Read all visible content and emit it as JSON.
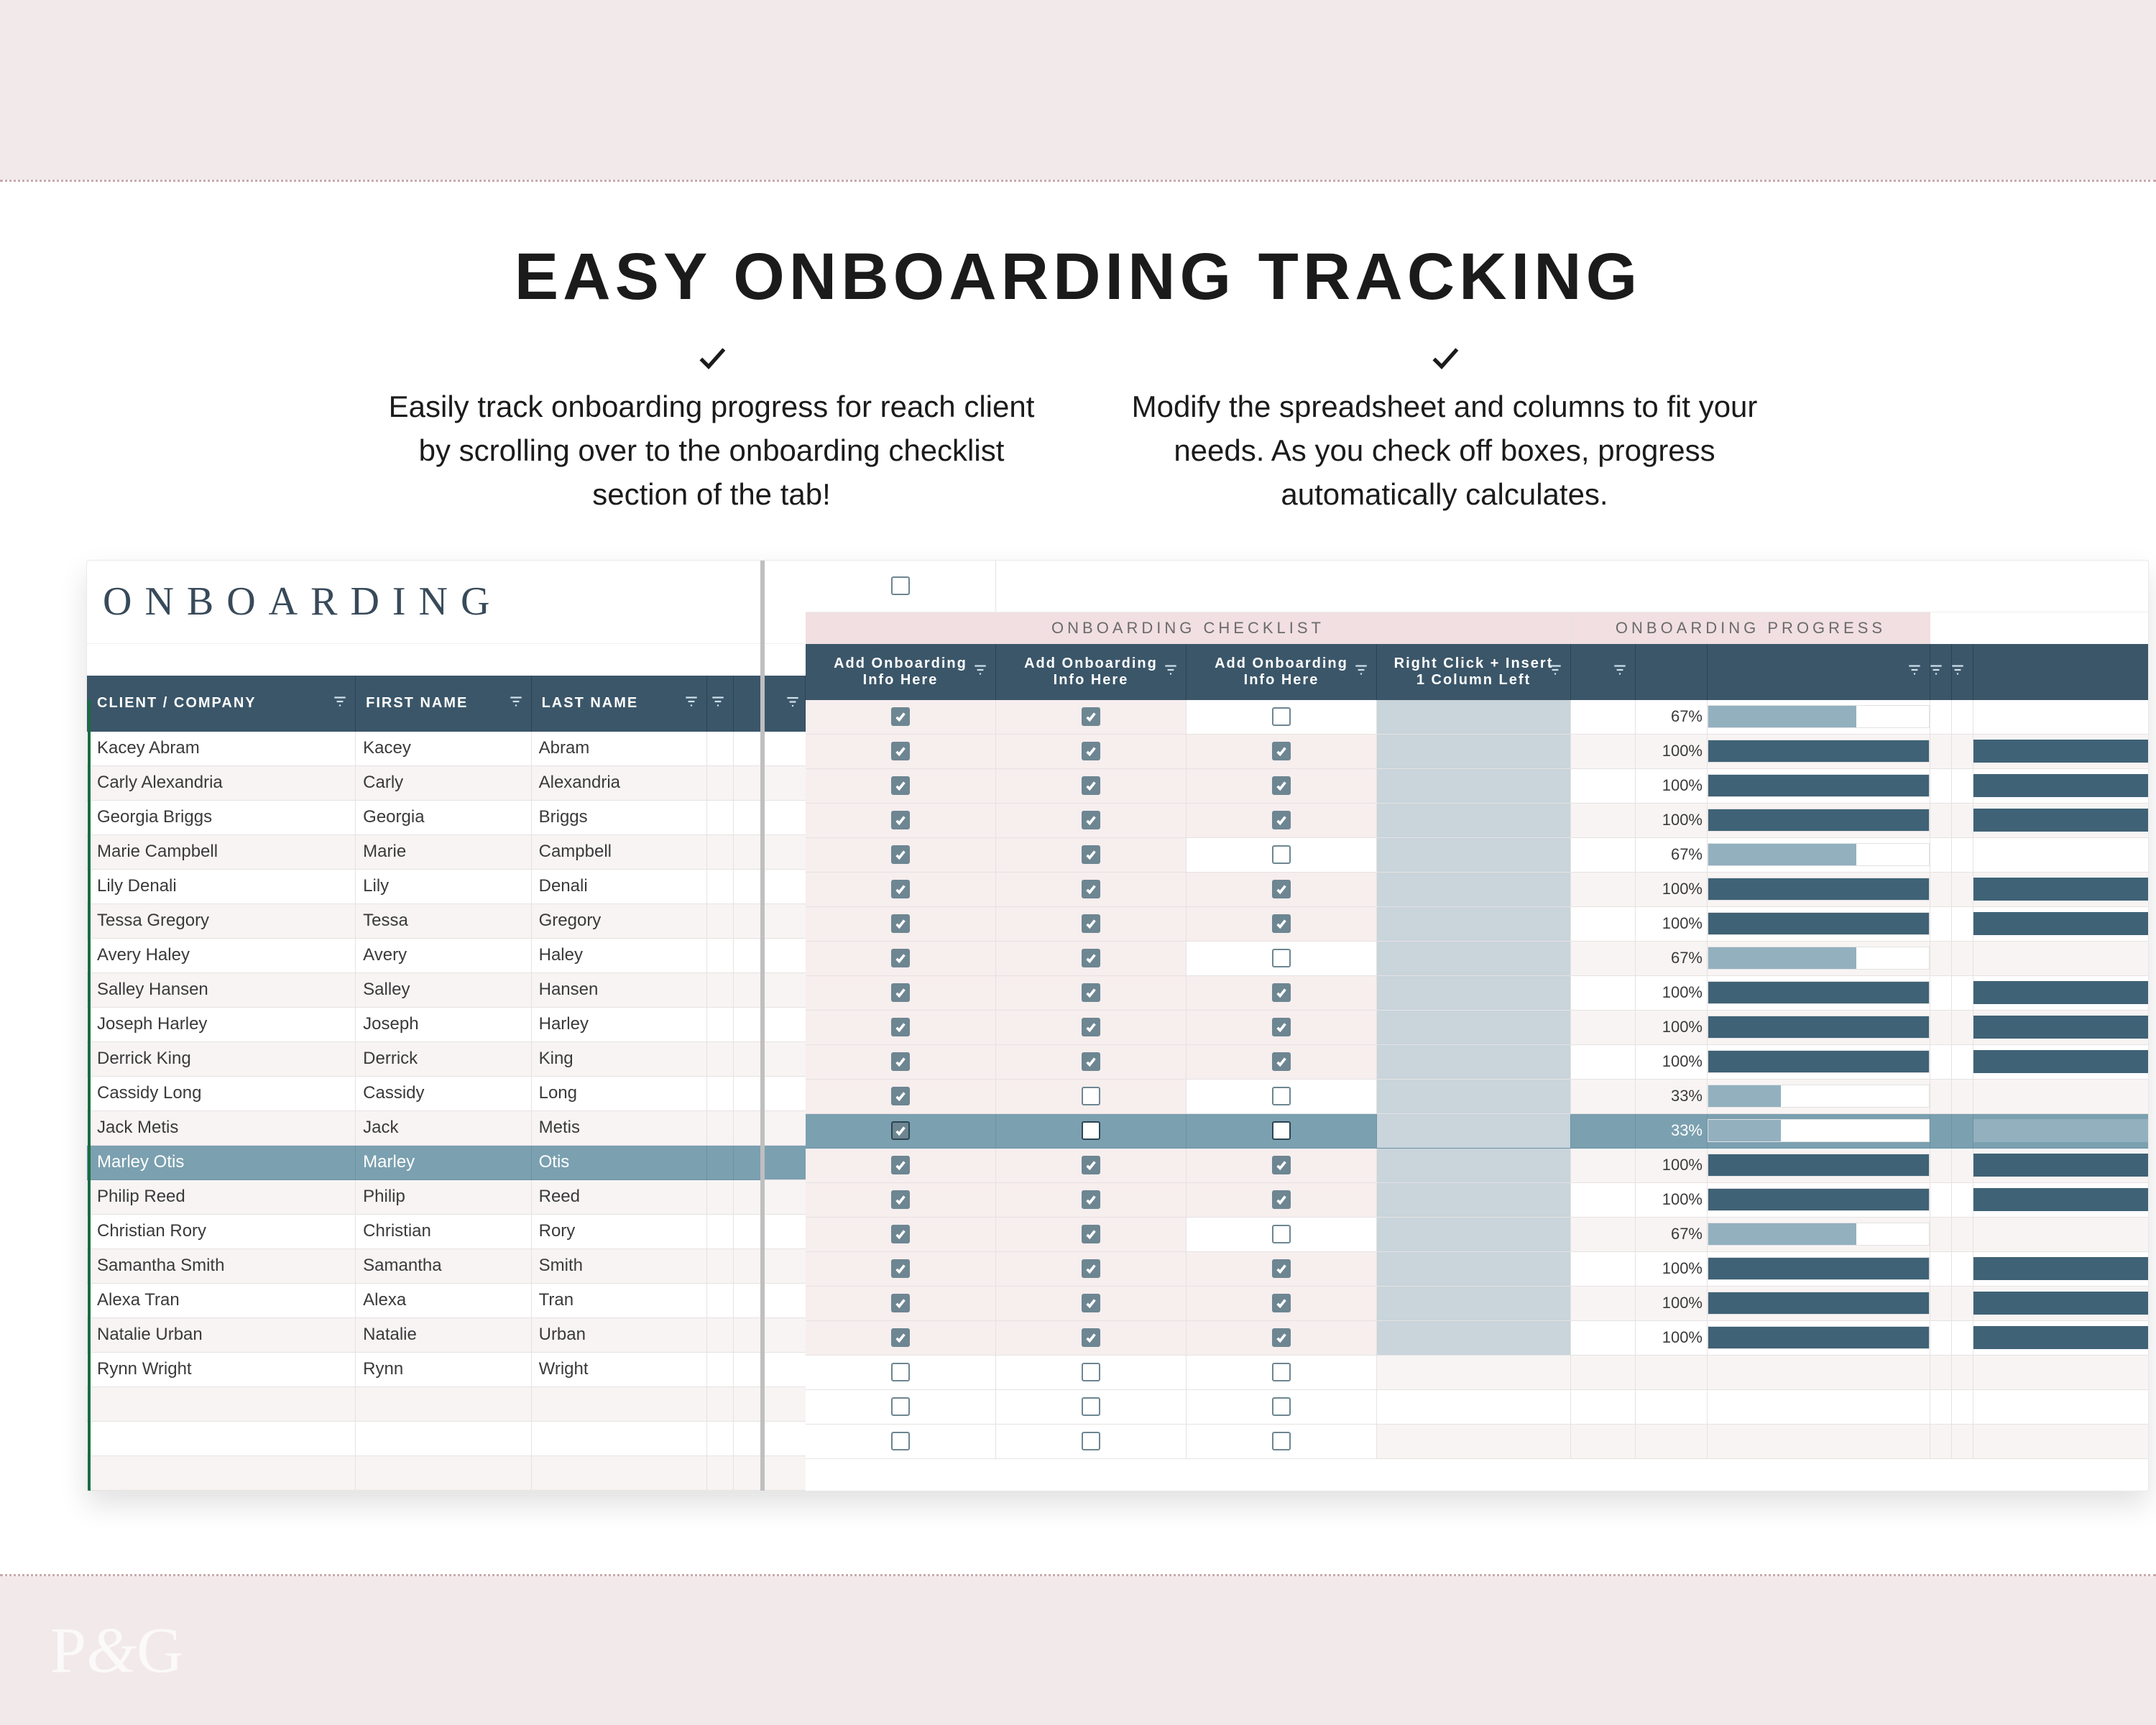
{
  "hero": {
    "title": "EASY ONBOARDING TRACKING",
    "feature_a": "Easily track onboarding progress for reach client by scrolling over to the onboarding checklist section of the tab!",
    "feature_b": "Modify the spreadsheet and columns to fit your needs. As you check off boxes, progress automatically calculates."
  },
  "sheet": {
    "title": "ONBOARDING",
    "section_labels": {
      "checklist": "ONBOARDING CHECKLIST",
      "progress": "ONBOARDING PROGRESS"
    },
    "columns": {
      "company": "CLIENT / COMPANY",
      "first": "FIRST NAME",
      "last": "LAST NAME",
      "chk1": "Add Onboarding Info Here",
      "chk2": "Add Onboarding Info Here",
      "chk3": "Add Onboarding Info Here",
      "rc": "Right Click + Insert 1 Column Left"
    },
    "rows": [
      {
        "company": "Kacey Abram",
        "first": "Kacey",
        "last": "Abram",
        "c": [
          true,
          true,
          false
        ],
        "pct": 67
      },
      {
        "company": "Carly Alexandria",
        "first": "Carly",
        "last": "Alexandria",
        "c": [
          true,
          true,
          true
        ],
        "pct": 100
      },
      {
        "company": "Georgia Briggs",
        "first": "Georgia",
        "last": "Briggs",
        "c": [
          true,
          true,
          true
        ],
        "pct": 100
      },
      {
        "company": "Marie Campbell",
        "first": "Marie",
        "last": "Campbell",
        "c": [
          true,
          true,
          true
        ],
        "pct": 100
      },
      {
        "company": "Lily Denali",
        "first": "Lily",
        "last": "Denali",
        "c": [
          true,
          true,
          false
        ],
        "pct": 67
      },
      {
        "company": "Tessa Gregory",
        "first": "Tessa",
        "last": "Gregory",
        "c": [
          true,
          true,
          true
        ],
        "pct": 100
      },
      {
        "company": "Avery Haley",
        "first": "Avery",
        "last": "Haley",
        "c": [
          true,
          true,
          true
        ],
        "pct": 100
      },
      {
        "company": "Salley Hansen",
        "first": "Salley",
        "last": "Hansen",
        "c": [
          true,
          true,
          false
        ],
        "pct": 67
      },
      {
        "company": "Joseph Harley",
        "first": "Joseph",
        "last": "Harley",
        "c": [
          true,
          true,
          true
        ],
        "pct": 100
      },
      {
        "company": "Derrick King",
        "first": "Derrick",
        "last": "King",
        "c": [
          true,
          true,
          true
        ],
        "pct": 100
      },
      {
        "company": "Cassidy Long",
        "first": "Cassidy",
        "last": "Long",
        "c": [
          true,
          true,
          true
        ],
        "pct": 100
      },
      {
        "company": "Jack Metis",
        "first": "Jack",
        "last": "Metis",
        "c": [
          true,
          false,
          false
        ],
        "pct": 33
      },
      {
        "company": "Marley Otis",
        "first": "Marley",
        "last": "Otis",
        "c": [
          true,
          false,
          false
        ],
        "pct": 33,
        "highlight": true
      },
      {
        "company": "Philip Reed",
        "first": "Philip",
        "last": "Reed",
        "c": [
          true,
          true,
          true
        ],
        "pct": 100
      },
      {
        "company": "Christian Rory",
        "first": "Christian",
        "last": "Rory",
        "c": [
          true,
          true,
          true
        ],
        "pct": 100
      },
      {
        "company": "Samantha Smith",
        "first": "Samantha",
        "last": "Smith",
        "c": [
          true,
          true,
          false
        ],
        "pct": 67
      },
      {
        "company": "Alexa Tran",
        "first": "Alexa",
        "last": "Tran",
        "c": [
          true,
          true,
          true
        ],
        "pct": 100
      },
      {
        "company": "Natalie Urban",
        "first": "Natalie",
        "last": "Urban",
        "c": [
          true,
          true,
          true
        ],
        "pct": 100
      },
      {
        "company": "Rynn Wright",
        "first": "Rynn",
        "last": "Wright",
        "c": [
          true,
          true,
          true
        ],
        "pct": 100
      },
      {
        "company": "",
        "first": "",
        "last": "",
        "c": [
          false,
          false,
          false
        ],
        "pct": null
      },
      {
        "company": "",
        "first": "",
        "last": "",
        "c": [
          false,
          false,
          false
        ],
        "pct": null
      },
      {
        "company": "",
        "first": "",
        "last": "",
        "c": [
          false,
          false,
          false
        ],
        "pct": null
      }
    ]
  },
  "footer": {
    "brand": "P&G"
  },
  "colors": {
    "header_dark": "#3b5669",
    "pink_light": "#f1dfe1",
    "teal_highlight": "#7ba0b0",
    "progress_full": "#3f6276",
    "progress_partial": "#93b0bf",
    "blush": "#f2e9ea"
  }
}
